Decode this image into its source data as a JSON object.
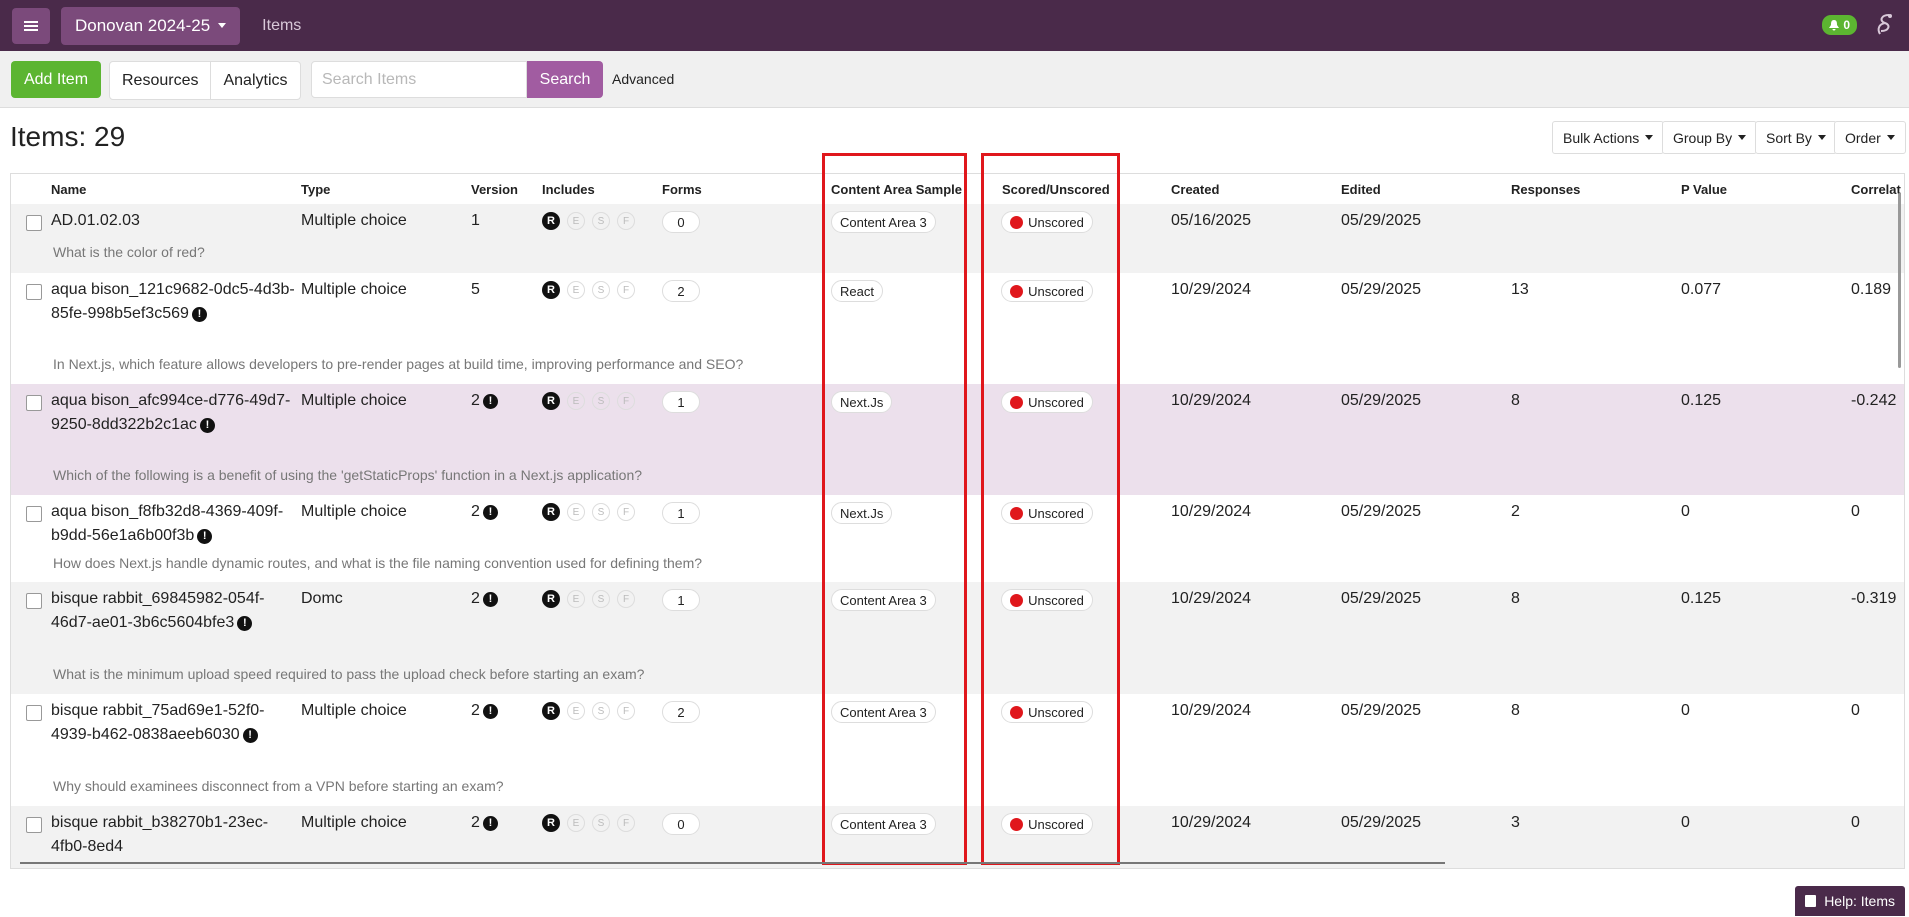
{
  "topbar": {
    "org": "Donovan 2024-25",
    "crumb": "Items",
    "notifications": "0",
    "menu_icon": "hamburger-icon",
    "bell_icon": "bell-icon",
    "logo_icon": "app-logo-icon"
  },
  "toolbar": {
    "add_label": "Add Item",
    "resources_label": "Resources",
    "analytics_label": "Analytics",
    "search_placeholder": "Search Items",
    "search_label": "Search",
    "advanced_label": "Advanced"
  },
  "summary": {
    "count_label": "Items: 29",
    "bulk_actions": "Bulk Actions",
    "group_by": "Group By",
    "sort_by": "Sort By",
    "order": "Order"
  },
  "columns": [
    "Name",
    "Type",
    "Version",
    "Includes",
    "Forms",
    "Content Area Sample",
    "Scored/Unscored",
    "Created",
    "Edited",
    "Responses",
    "P Value",
    "Correlat"
  ],
  "includes_letters": [
    "R",
    "E",
    "S",
    "F"
  ],
  "rows": [
    {
      "name": "AD.01.02.03",
      "warn": false,
      "type": "Multiple choice",
      "version": "1",
      "version_warn": false,
      "forms": "0",
      "area": "Content Area 3",
      "scored": "Unscored",
      "created": "05/16/2025",
      "edited": "05/29/2025",
      "responses": "",
      "pvalue": "",
      "corr": "",
      "desc": "What is the color of red?"
    },
    {
      "name": "aqua bison_121c9682-0dc5-4d3b-85fe-998b5ef3c569",
      "warn": true,
      "type": "Multiple choice",
      "version": "5",
      "version_warn": false,
      "forms": "2",
      "area": "React",
      "scored": "Unscored",
      "created": "10/29/2024",
      "edited": "05/29/2025",
      "responses": "13",
      "pvalue": "0.077",
      "corr": "0.189",
      "desc": "In Next.js, which feature allows developers to pre-render pages at build time, improving performance and SEO?"
    },
    {
      "name": "aqua bison_afc994ce-d776-49d7-9250-8dd322b2c1ac",
      "warn": true,
      "type": "Multiple choice",
      "version": "2",
      "version_warn": true,
      "forms": "1",
      "area": "Next.Js",
      "scored": "Unscored",
      "created": "10/29/2024",
      "edited": "05/29/2025",
      "responses": "8",
      "pvalue": "0.125",
      "corr": "-0.242",
      "desc": "Which of the following is a benefit of using the 'getStaticProps' function in a Next.js application?"
    },
    {
      "name": "aqua bison_f8fb32d8-4369-409f-b9dd-56e1a6b00f3b",
      "warn": true,
      "type": "Multiple choice",
      "version": "2",
      "version_warn": true,
      "forms": "1",
      "area": "Next.Js",
      "scored": "Unscored",
      "created": "10/29/2024",
      "edited": "05/29/2025",
      "responses": "2",
      "pvalue": "0",
      "corr": "0",
      "desc": "How does Next.js handle dynamic routes, and what is the file naming convention used for defining them?"
    },
    {
      "name": "bisque rabbit_69845982-054f-46d7-ae01-3b6c5604bfe3",
      "warn": true,
      "type": "Domc",
      "version": "2",
      "version_warn": true,
      "forms": "1",
      "area": "Content Area 3",
      "scored": "Unscored",
      "created": "10/29/2024",
      "edited": "05/29/2025",
      "responses": "8",
      "pvalue": "0.125",
      "corr": "-0.319",
      "desc": "What is the minimum upload speed required to pass the upload check before starting an exam?"
    },
    {
      "name": "bisque rabbit_75ad69e1-52f0-4939-b462-0838aeeb6030",
      "warn": true,
      "type": "Multiple choice",
      "version": "2",
      "version_warn": true,
      "forms": "2",
      "area": "Content Area 3",
      "scored": "Unscored",
      "created": "10/29/2024",
      "edited": "05/29/2025",
      "responses": "8",
      "pvalue": "0",
      "corr": "0",
      "desc": "Why should examinees disconnect from a VPN before starting an exam?"
    },
    {
      "name": "bisque rabbit_b38270b1-23ec-4fb0-8ed4",
      "warn": false,
      "type": "Multiple choice",
      "version": "2",
      "version_warn": true,
      "forms": "0",
      "area": "Content Area 3",
      "scored": "Unscored",
      "created": "10/29/2024",
      "edited": "05/29/2025",
      "responses": "3",
      "pvalue": "0",
      "corr": "0",
      "desc": ""
    }
  ],
  "colors": {
    "topbar": "#4a2a4a",
    "accent": "#a15ca1",
    "add": "#5cb531",
    "highlight": "#e0171c",
    "selected_row": "#ece0ec"
  },
  "help": {
    "label": "Help: Items",
    "icon": "book-icon"
  }
}
